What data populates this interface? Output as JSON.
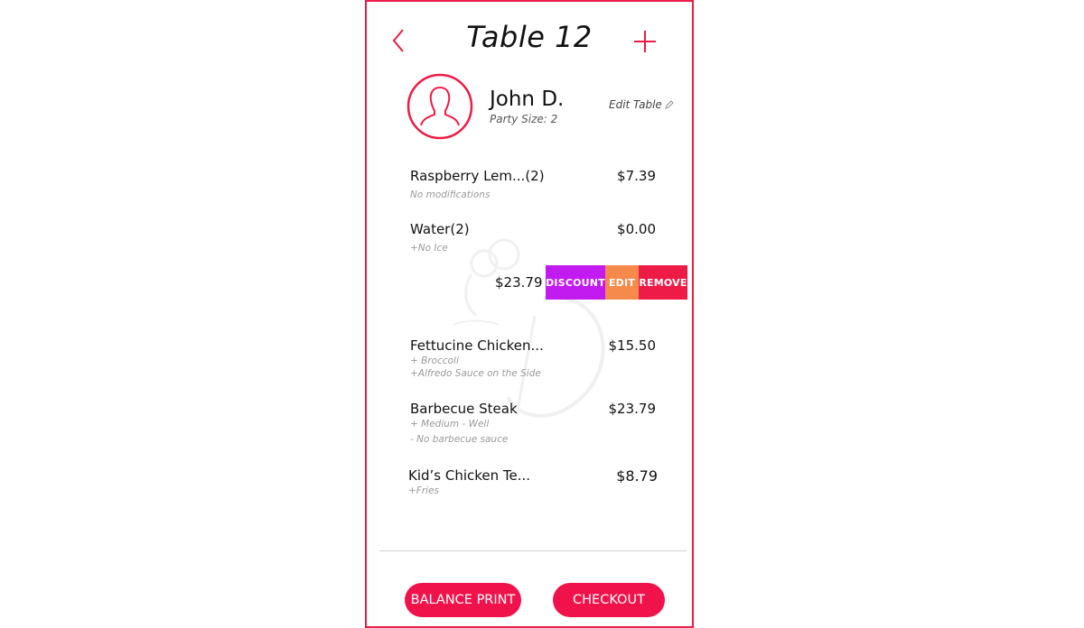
{
  "header": {
    "title": "Table 12",
    "back_icon": "chevron-left-icon",
    "add_icon": "plus-icon"
  },
  "customer": {
    "name": "John D.",
    "party_size": "Party Size: 2",
    "edit_label": "Edit Table",
    "avatar_icon": "user-avatar-icon"
  },
  "items": [
    {
      "name": "Raspberry Lem...(2)",
      "price": "$7.39",
      "mods": [
        "No modifications"
      ]
    },
    {
      "name": "Water(2)",
      "price": "$0.00",
      "mods": [
        "+No Ice"
      ]
    },
    {
      "name": "Fettucine Chicken...",
      "price": "$15.50",
      "mods": [
        "+ Broccoli",
        "+Alfredo Sauce on the Side"
      ]
    },
    {
      "name": "Barbecue Steak",
      "price": "$23.79",
      "mods": [
        "+ Medium - Well",
        "- No barbecue sauce"
      ]
    },
    {
      "name": "Kid’s Chicken Te...",
      "price": "$8.79",
      "mods": [
        "+Fries"
      ]
    }
  ],
  "swipe_row": {
    "price": "$23.79",
    "actions": {
      "discount": "DISCOUNT",
      "edit": "EDIT",
      "remove": "REMOVE"
    }
  },
  "footer": {
    "balance_print": "BALANCE PRINT",
    "checkout": "CHECKOUT"
  },
  "colors": {
    "accent": "#ec1c45",
    "discount": "#c21bf0",
    "edit": "#f58a4b",
    "remove": "#ee1b46"
  }
}
